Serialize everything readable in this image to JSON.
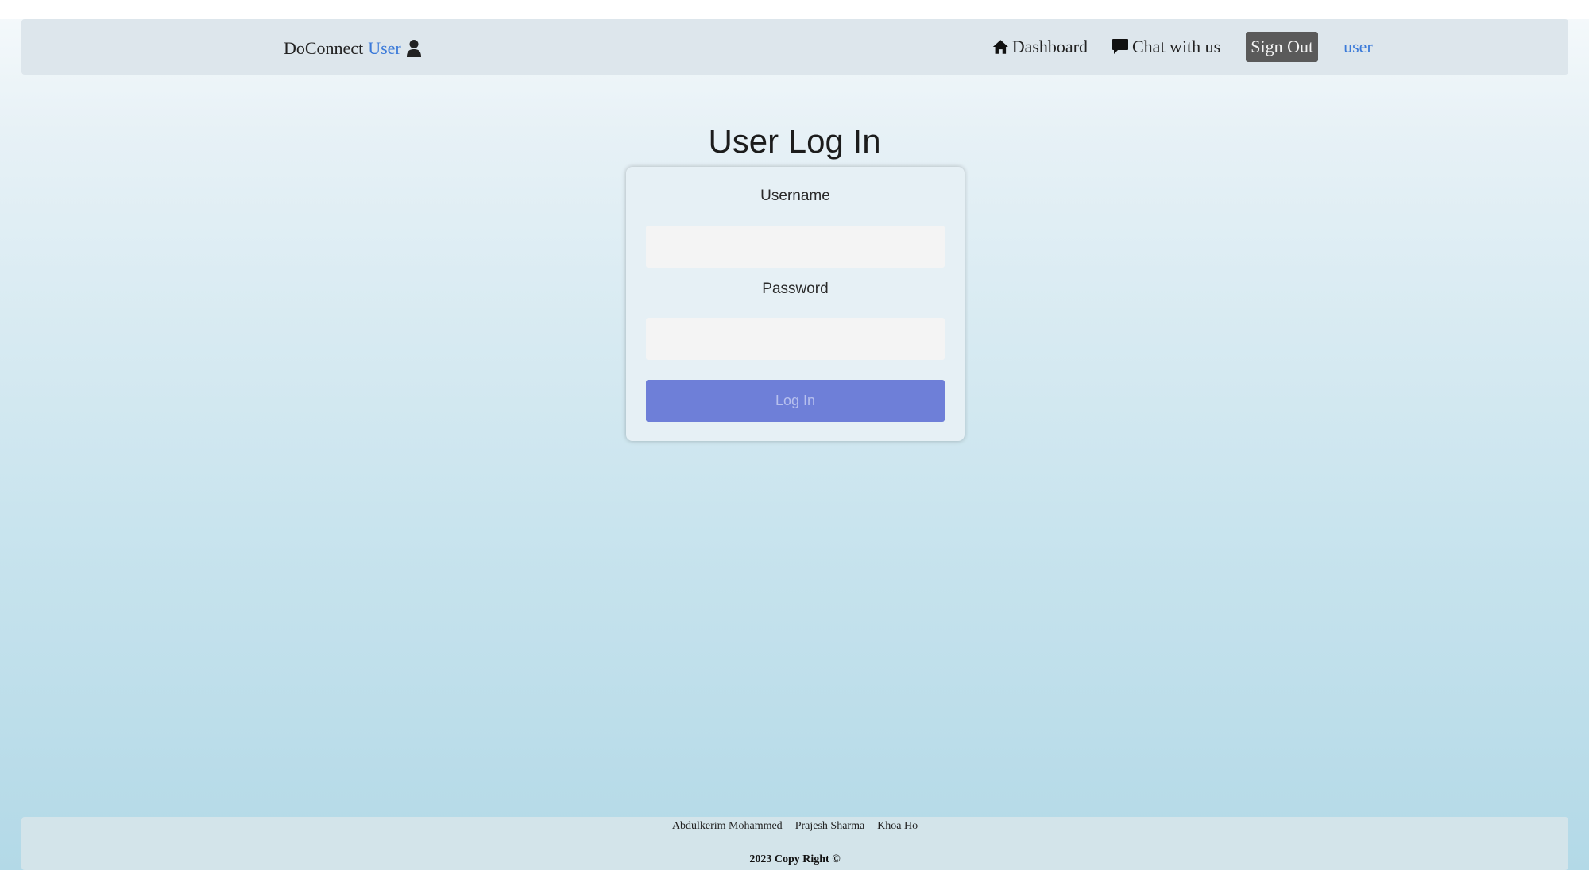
{
  "nav": {
    "brand": "DoConnect",
    "brand_accent": "User",
    "links": {
      "dashboard": "Dashboard",
      "chat": "Chat with us",
      "signout": "Sign Out",
      "user": "user"
    }
  },
  "main": {
    "title": "User Log In",
    "form": {
      "username_label": "Username",
      "username_value": "",
      "password_label": "Password",
      "password_value": "",
      "submit_label": "Log In"
    }
  },
  "footer": {
    "authors": [
      "Abdulkerim Mohammed",
      "Prajesh Sharma",
      "Khoa Ho"
    ],
    "copyright": "2023 Copy Right ©"
  },
  "colors": {
    "accent": "#3b7ad9",
    "button": "#6e7fd8",
    "signout_bg": "#5a5a5a"
  },
  "icons": [
    "user-icon",
    "home-icon",
    "chat-bubble-icon"
  ]
}
